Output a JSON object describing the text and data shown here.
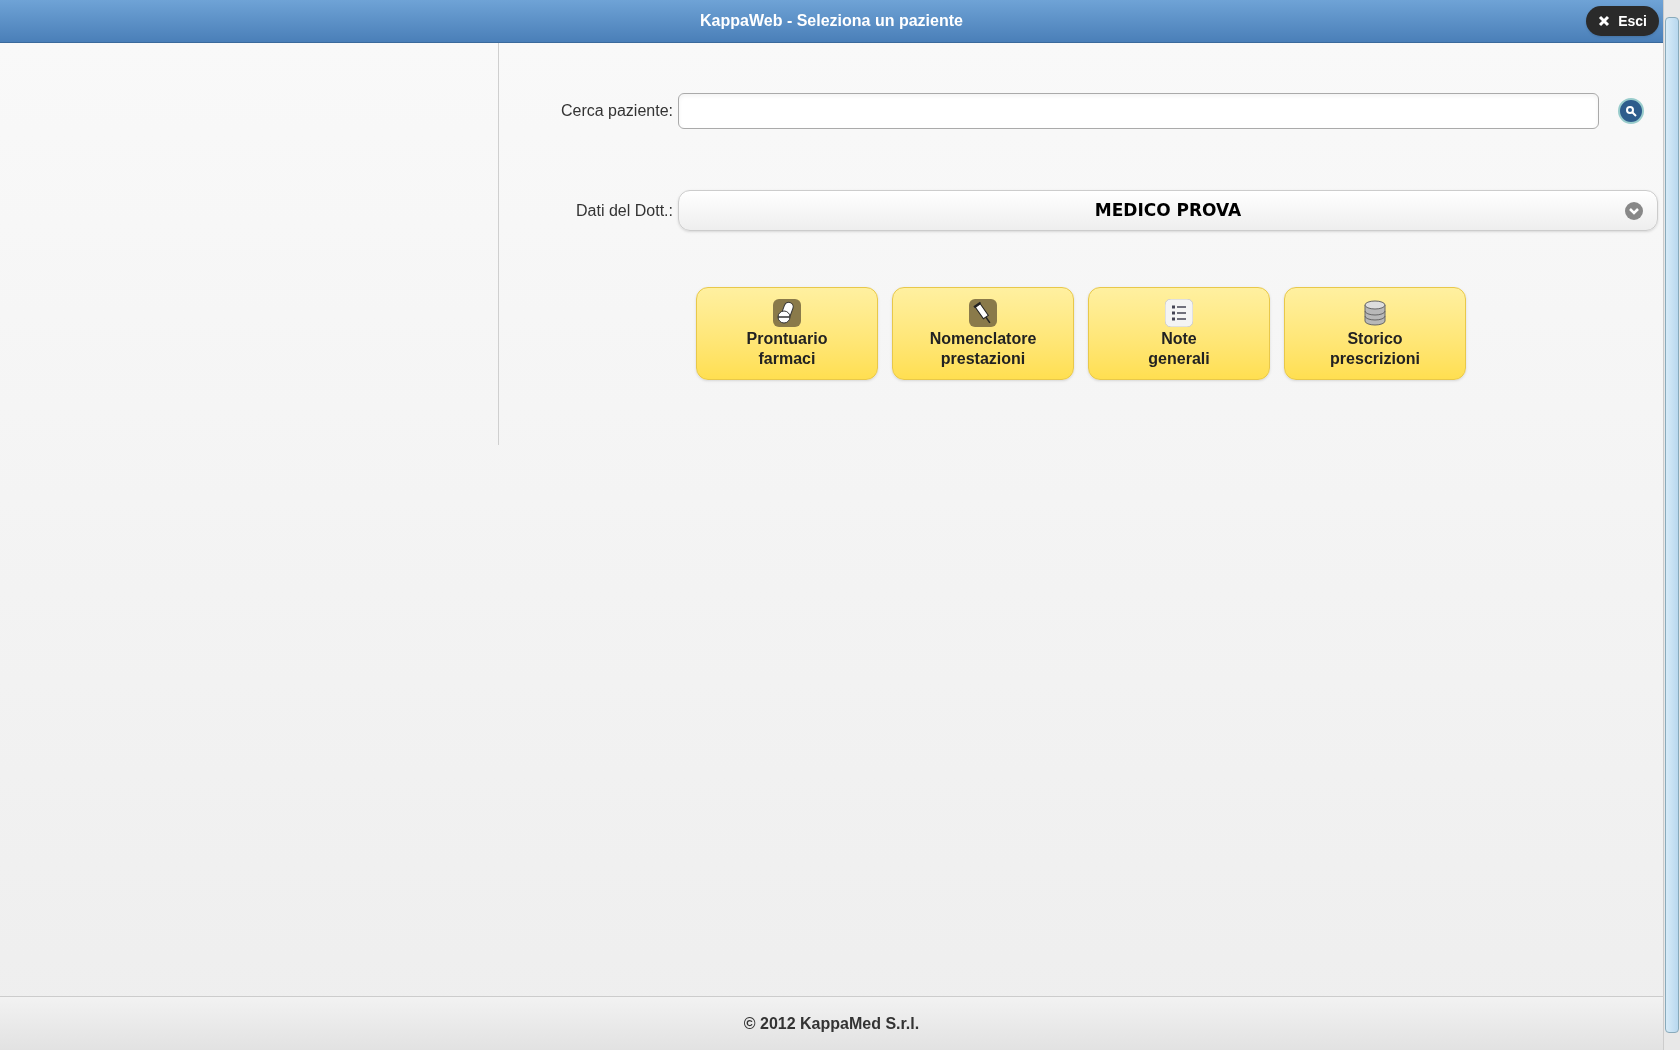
{
  "header": {
    "title": "KappaWeb - Seleziona un paziente",
    "exit_button": "Esci"
  },
  "search": {
    "label": "Cerca paziente:"
  },
  "doctor": {
    "label": "Dati del Dott.:",
    "value": "MEDICO PROVA"
  },
  "buttons": [
    {
      "kind": "pills",
      "lines": [
        "Prontuario",
        "farmaci"
      ]
    },
    {
      "kind": "syringe",
      "lines": [
        "Nomenclatore",
        "prestazioni"
      ]
    },
    {
      "kind": "list",
      "lines": [
        "Note",
        "generali"
      ]
    },
    {
      "kind": "database",
      "lines": [
        "Storico",
        "prescrizioni"
      ]
    }
  ],
  "footer": "© 2012 KappaMed S.r.l."
}
